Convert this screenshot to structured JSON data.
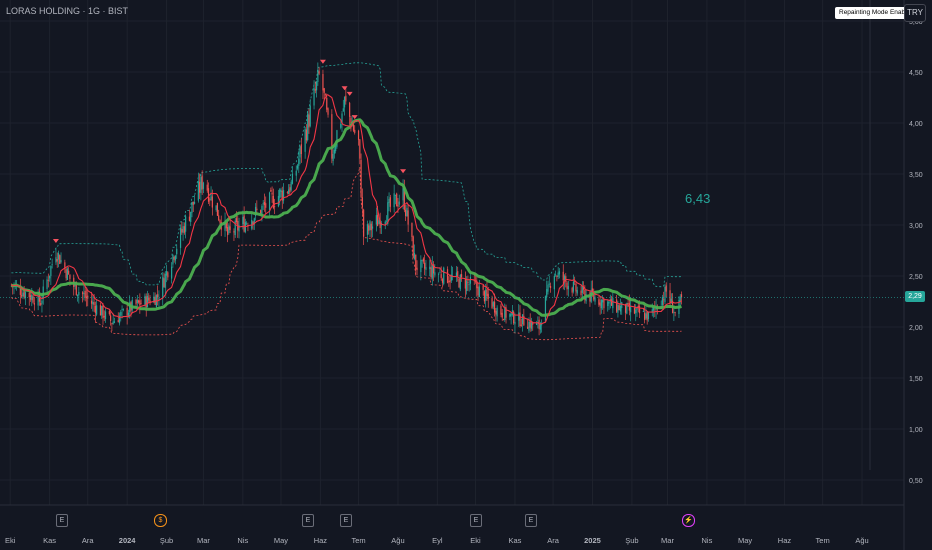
{
  "header": {
    "title": "LORAS HOLDING · 1G · BIST"
  },
  "badge": {
    "label": "Repainting Mode Enabled"
  },
  "currency": {
    "label": "TRY"
  },
  "last_price": {
    "label": "2,29"
  },
  "annotation": {
    "text": "6,43"
  },
  "events": {
    "earnings": "E",
    "dividend": "$",
    "split": "⚡"
  },
  "colors": {
    "background": "#131722",
    "grid": "#1e222d",
    "up": "#26a69a",
    "down": "#ef5350",
    "ma_fast": "#f23645",
    "ma_slow": "#4caf50",
    "band_upper": "#26a69a",
    "band_lower": "#ef5350",
    "signal": "#f7525f"
  },
  "chart_data": {
    "type": "candlestick",
    "title": "LORAS HOLDING · 1G · BIST",
    "yaxis": {
      "ticks": [
        "5,00",
        "4,50",
        "4,00",
        "3,50",
        "3,00",
        "2,50",
        "2,00",
        "1,50",
        "1,00",
        "0,50"
      ],
      "ylim": [
        0.4,
        5.0
      ]
    },
    "xaxis": {
      "ticks": [
        "Eki",
        "Kas",
        "Ara",
        "2024",
        "Şub",
        "Mar",
        "Nis",
        "May",
        "Haz",
        "Tem",
        "Ağu",
        "Eyl",
        "Eki",
        "Kas",
        "Ara",
        "2025",
        "Şub",
        "Mar",
        "Nis",
        "May",
        "Haz",
        "Tem",
        "Ağu"
      ]
    },
    "price_keypoints": [
      {
        "date": "2023-10-01",
        "close": 2.42
      },
      {
        "date": "2023-10-25",
        "close": 2.25
      },
      {
        "date": "2023-11-06",
        "close": 2.75
      },
      {
        "date": "2023-11-20",
        "close": 2.4
      },
      {
        "date": "2023-12-20",
        "close": 2.05
      },
      {
        "date": "2024-01-05",
        "close": 2.2
      },
      {
        "date": "2024-01-25",
        "close": 2.3
      },
      {
        "date": "2024-02-15",
        "close": 3.0
      },
      {
        "date": "2024-03-01",
        "close": 3.45
      },
      {
        "date": "2024-03-20",
        "close": 2.9
      },
      {
        "date": "2024-04-10",
        "close": 3.1
      },
      {
        "date": "2024-05-10",
        "close": 3.4
      },
      {
        "date": "2024-06-01",
        "close": 4.5
      },
      {
        "date": "2024-06-10",
        "close": 3.7
      },
      {
        "date": "2024-06-20",
        "close": 4.2
      },
      {
        "date": "2024-07-01",
        "close": 3.8
      },
      {
        "date": "2024-07-05",
        "close": 2.9
      },
      {
        "date": "2024-08-05",
        "close": 3.3
      },
      {
        "date": "2024-08-15",
        "close": 2.6
      },
      {
        "date": "2024-10-01",
        "close": 2.4
      },
      {
        "date": "2024-10-20",
        "close": 2.15
      },
      {
        "date": "2024-11-20",
        "close": 2.0
      },
      {
        "date": "2024-12-01",
        "close": 2.55
      },
      {
        "date": "2024-12-20",
        "close": 2.35
      },
      {
        "date": "2025-01-20",
        "close": 2.2
      },
      {
        "date": "2025-02-15",
        "close": 2.1
      },
      {
        "date": "2025-02-28",
        "close": 2.35
      },
      {
        "date": "2025-03-08",
        "close": 2.1
      },
      {
        "date": "2025-03-12",
        "close": 2.29
      }
    ],
    "last_close": 2.29
  }
}
